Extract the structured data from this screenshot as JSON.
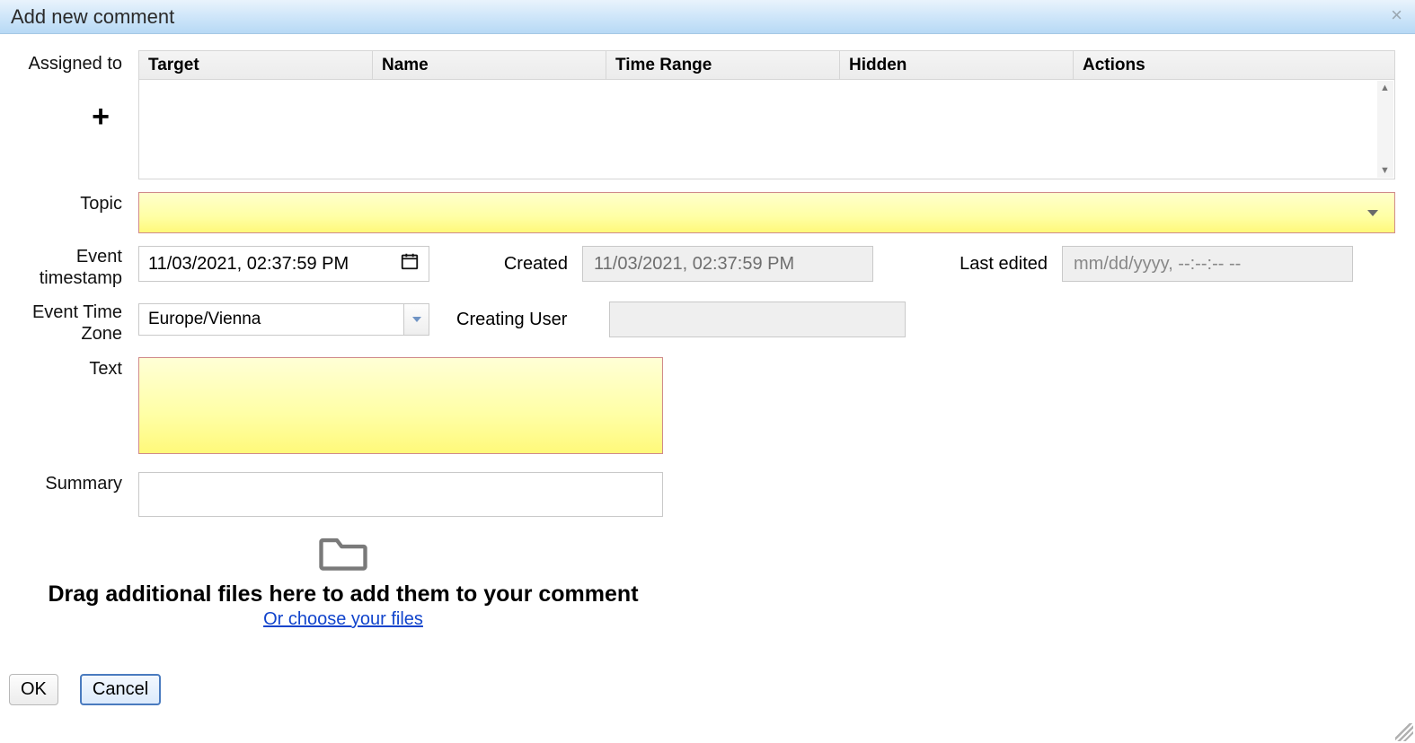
{
  "dialog": {
    "title": "Add new comment"
  },
  "labels": {
    "assigned_to": "Assigned to",
    "topic": "Topic",
    "event_timestamp": "Event timestamp",
    "event_timezone": "Event Time Zone",
    "created": "Created",
    "creating_user": "Creating User",
    "last_edited": "Last edited",
    "text": "Text",
    "summary": "Summary"
  },
  "table_headers": {
    "target": "Target",
    "name": "Name",
    "time_range": "Time Range",
    "hidden": "Hidden",
    "actions": "Actions"
  },
  "assigned_rows": [],
  "fields": {
    "topic_value": "",
    "event_timestamp_value": "11/03/2021, 02:37:59 PM",
    "created_value": "11/03/2021, 02:37:59 PM",
    "last_edited_placeholder": "mm/dd/yyyy, --:--:-- --",
    "event_timezone_value": "Europe/Vienna",
    "creating_user_value": "",
    "text_value": "",
    "summary_value": ""
  },
  "dropzone": {
    "title": "Drag additional files here to add them to your comment",
    "link": "Or choose your files"
  },
  "buttons": {
    "ok": "OK",
    "cancel": "Cancel"
  },
  "icons": {
    "add": "+"
  }
}
